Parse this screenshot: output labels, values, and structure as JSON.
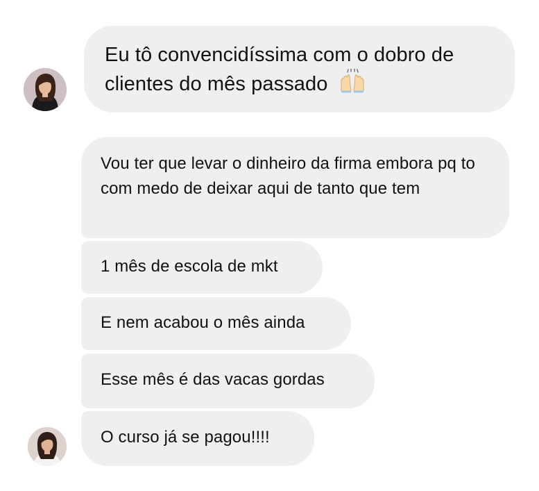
{
  "conversation": {
    "first_message": {
      "text": "Eu tô convencidíssima com o dobro de clientes do mês passado",
      "emoji": "raising-hands-emoji"
    },
    "messages": [
      {
        "text": "Vou ter que levar o dinheiro da firma embora pq to com medo de deixar aqui de tanto que tem"
      },
      {
        "text": "1 mês de escola de mkt"
      },
      {
        "text": "E nem acabou o mês ainda"
      },
      {
        "text": "Esse mês é das vacas gordas"
      },
      {
        "text": "O curso já se pagou!!!!"
      }
    ]
  },
  "colors": {
    "bubble_bg": "#efeff0",
    "text": "#111111",
    "background": "#ffffff"
  }
}
